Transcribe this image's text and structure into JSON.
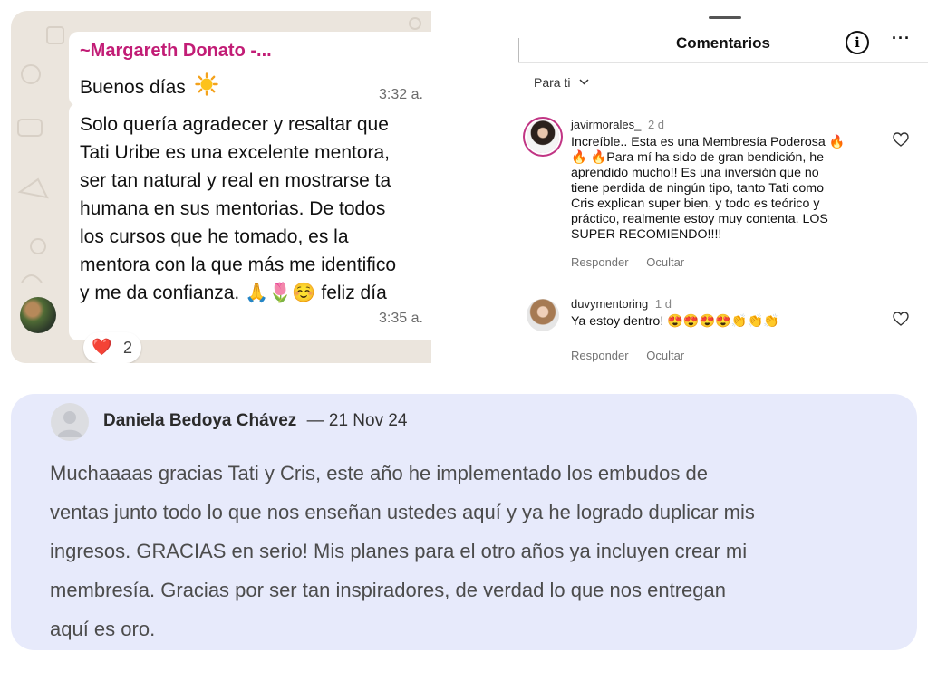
{
  "whatsapp": {
    "sender": "~Margareth Donato -...",
    "message1": "Buenos días",
    "time1": "3:32 a.",
    "message2_lines": [
      "Solo quería agradecer y resaltar que",
      "Tati Uribe es una excelente mentora,",
      "ser tan natural y real en mostrarse ta",
      "humana en sus mentorias. De todos",
      "los cursos que he tomado, es la",
      "mentora con la que más me identifico",
      "y me da confianza. 🙏🌷☺️ feliz día"
    ],
    "time2": "3:35 a.",
    "reaction_emoji": "❤️",
    "reaction_count": "2",
    "icons": [
      "sun-icon",
      "avatar",
      "heart-icon"
    ]
  },
  "instagram": {
    "title": "Comentarios",
    "info_glyph": "i",
    "more_glyph": "···",
    "filter": "Para ti",
    "comments": [
      {
        "user": "javirmorales_",
        "when": "2 d",
        "text_lines": [
          "Increíble.. Esta es una Membresía Poderosa 🔥",
          "🔥 🔥Para mí ha sido de gran bendición,  he",
          "aprendido mucho!! Es una inversión que no",
          "tiene perdida de ningún tipo, tanto Tati como",
          "Cris explican super bien, y todo es teórico y",
          "práctico, realmente estoy muy contenta. LOS",
          "SUPER RECOMIENDO!!!!"
        ],
        "reply": "Responder",
        "hide": "Ocultar"
      },
      {
        "user": "duvymentoring",
        "when": "1 d",
        "text_lines": [
          "Ya estoy dentro! 😍😍😍😍👏👏👏"
        ],
        "reply": "Responder",
        "hide": "Ocultar"
      }
    ]
  },
  "testimonial": {
    "name": "Daniela Bedoya Chávez",
    "separator": "—",
    "date": "21 Nov 24",
    "body_lines": [
      "Muchaaaas gracias Tati y Cris, este año he implementado los embudos de",
      "ventas junto todo lo que nos enseñan ustedes aquí y ya he logrado duplicar mis",
      "ingresos. GRACIAS en serio! Mis planes para el otro años ya incluyen crear mi",
      "membresía. Gracias por ser tan inspiradores, de verdad lo que nos entregan",
      "aquí es oro."
    ]
  },
  "colors": {
    "whatsapp_bg": "#ebe5dd",
    "sender_pink": "#c21d76",
    "card_bg": "#e7eafb",
    "ig_story_ring": "#c13584"
  }
}
